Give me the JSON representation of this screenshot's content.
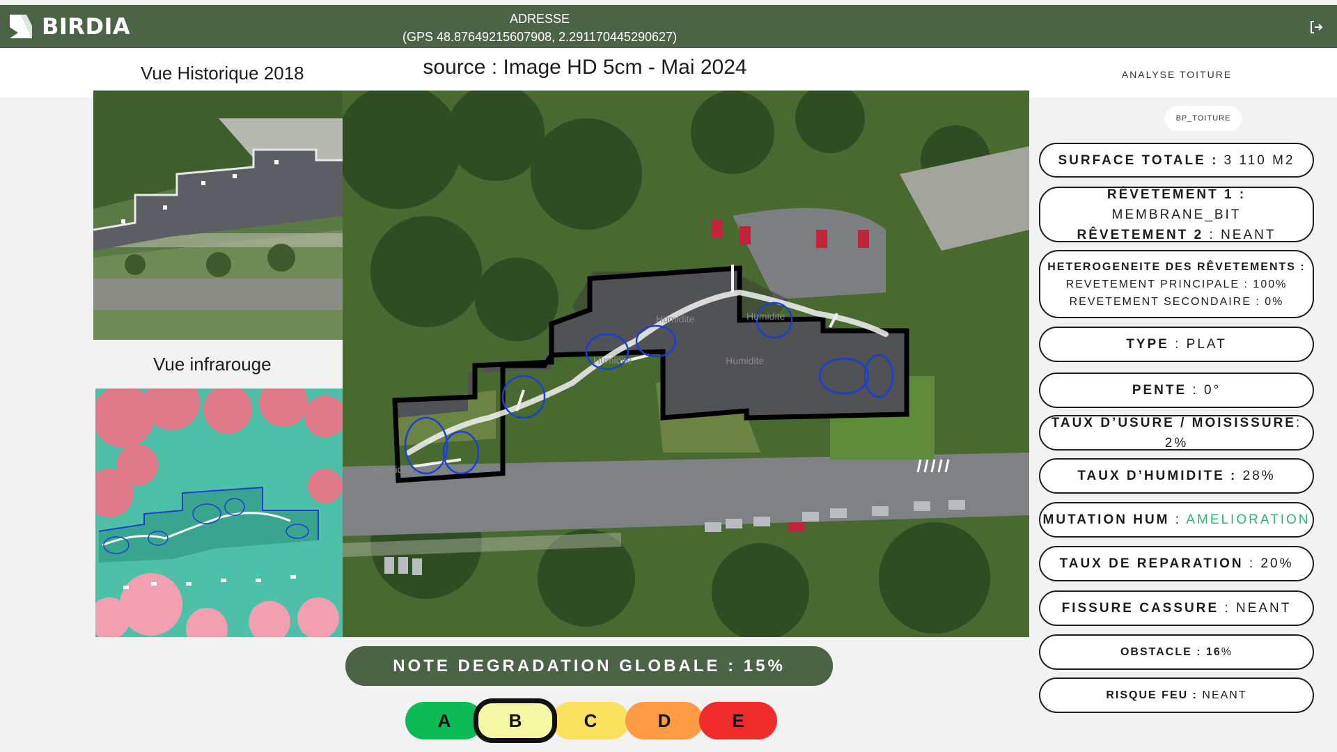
{
  "header": {
    "app_name": "BIRDIA",
    "address_title": "ADRESSE",
    "gps": "(GPS 48.87649215607908, 2.291170445290627)",
    "logout_icon": "logout-icon"
  },
  "views": {
    "historique_label": "Vue Historique 2018",
    "infrarouge_label": "Vue infrarouge",
    "source_label": "source : Image HD 5cm - Mai 2024"
  },
  "panel": {
    "title": "ANALYSE TOITURE",
    "tag": "BP_TOITURE",
    "surface_key": "SURFACE TOTALE :",
    "surface_val": " 3 110 M2",
    "rev1_key": "RÊVETEMENT 1 :",
    "rev1_val": " MEMBRANE_BIT",
    "rev2_key": "RÊVETEMENT 2",
    "rev2_val": " : NEANT",
    "hetero_key": "HETEROGENEITE DES RÊVETEMENTS :",
    "hetero_line1": "REVETEMENT PRINCIPALE : 100%",
    "hetero_line2": "REVETEMENT SECONDAIRE : 0%",
    "type_key": "TYPE",
    "type_val": " : PLAT",
    "pente_key": "PENTE",
    "pente_val": " : 0°",
    "usure_key": "TAUX D’USURE / MOISISSURE",
    "usure_val": ": 2%",
    "humidite_key": "TAUX D’HUMIDITE :",
    "humidite_val": " 28%",
    "mutation_key": "MUTATION HUM",
    "mutation_sep": " : ",
    "mutation_val": "AMELIORATION",
    "reparation_key": "TAUX DE REPARATION",
    "reparation_val": " : 20%",
    "fissure_key": "FISSURE CASSURE",
    "fissure_val": " : NEANT",
    "obstacle_key": "OBSTACLE : 16",
    "obstacle_val": "%",
    "feu_key": "RISQUE FEU :",
    "feu_val": " NEANT"
  },
  "note": {
    "label": "NOTE DEGRADATION GLOBALE : 15%"
  },
  "grades": [
    {
      "label": "A",
      "color": "#0dba55"
    },
    {
      "label": "B",
      "color": "#f5f7a4",
      "selected": true
    },
    {
      "label": "C",
      "color": "#fce060"
    },
    {
      "label": "D",
      "color": "#ff9a45"
    },
    {
      "label": "E",
      "color": "#ef2c2c"
    }
  ],
  "map_labels": {
    "humidite": "Humidite"
  },
  "colors": {
    "brand_green": "#4a6445",
    "mutation_green": "#2bb673"
  }
}
